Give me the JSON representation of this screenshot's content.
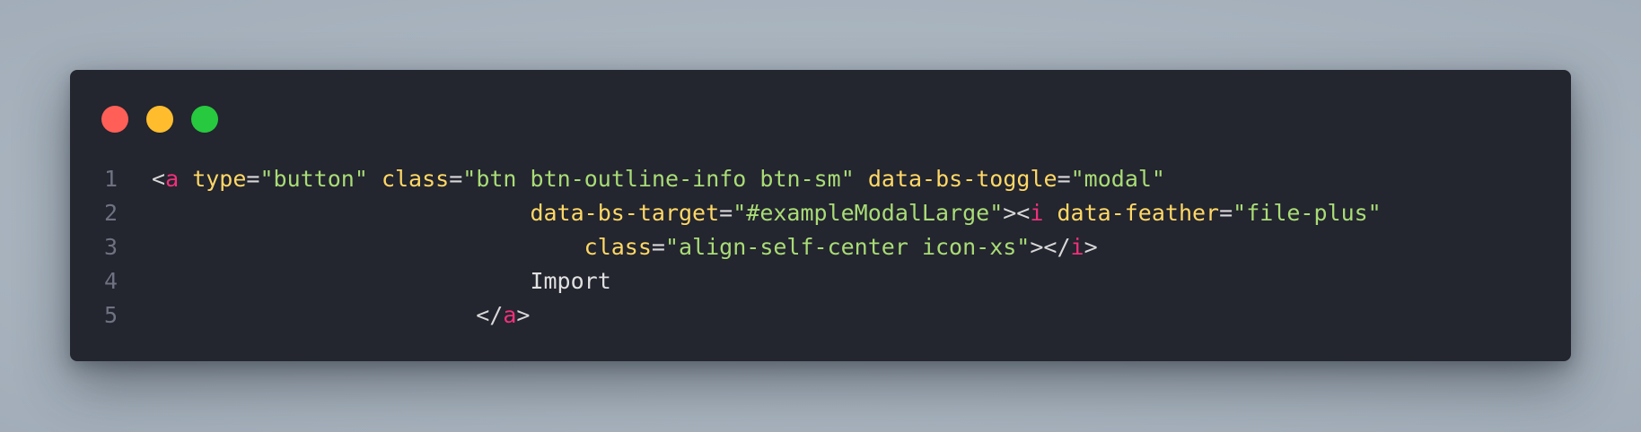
{
  "window": {
    "controls": [
      "close-dot",
      "minimize-dot",
      "maximize-dot"
    ],
    "colors": {
      "close": "#ff5f56",
      "minimize": "#ffbd2e",
      "maximize": "#27c93f",
      "background": "#23252f"
    }
  },
  "code": {
    "lines": [
      {
        "number": "1",
        "indent": "",
        "tokens": [
          {
            "t": "punc",
            "v": "<"
          },
          {
            "t": "tag",
            "v": "a"
          },
          {
            "t": "punc",
            "v": " "
          },
          {
            "t": "attr",
            "v": "type"
          },
          {
            "t": "eq",
            "v": "="
          },
          {
            "t": "str",
            "v": "\"button\""
          },
          {
            "t": "punc",
            "v": " "
          },
          {
            "t": "attr",
            "v": "class"
          },
          {
            "t": "eq",
            "v": "="
          },
          {
            "t": "str",
            "v": "\"btn btn-outline-info btn-sm\""
          },
          {
            "t": "punc",
            "v": " "
          },
          {
            "t": "attr",
            "v": "data-bs-toggle"
          },
          {
            "t": "eq",
            "v": "="
          },
          {
            "t": "str",
            "v": "\"modal\""
          }
        ]
      },
      {
        "number": "2",
        "indent": "                            ",
        "tokens": [
          {
            "t": "attr",
            "v": "data-bs-target"
          },
          {
            "t": "eq",
            "v": "="
          },
          {
            "t": "str",
            "v": "\"#exampleModalLarge\""
          },
          {
            "t": "punc",
            "v": "><"
          },
          {
            "t": "tag",
            "v": "i"
          },
          {
            "t": "punc",
            "v": " "
          },
          {
            "t": "attr",
            "v": "data-feather"
          },
          {
            "t": "eq",
            "v": "="
          },
          {
            "t": "str",
            "v": "\"file-plus\""
          }
        ]
      },
      {
        "number": "3",
        "indent": "                                ",
        "tokens": [
          {
            "t": "attr",
            "v": "class"
          },
          {
            "t": "eq",
            "v": "="
          },
          {
            "t": "str",
            "v": "\"align-self-center icon-xs\""
          },
          {
            "t": "punc",
            "v": "></"
          },
          {
            "t": "tag",
            "v": "i"
          },
          {
            "t": "punc",
            "v": ">"
          }
        ]
      },
      {
        "number": "4",
        "indent": "                            ",
        "tokens": [
          {
            "t": "txt",
            "v": "Import"
          }
        ]
      },
      {
        "number": "5",
        "indent": "                        ",
        "tokens": [
          {
            "t": "punc",
            "v": "</"
          },
          {
            "t": "tag",
            "v": "a"
          },
          {
            "t": "punc",
            "v": ">"
          }
        ]
      }
    ]
  }
}
